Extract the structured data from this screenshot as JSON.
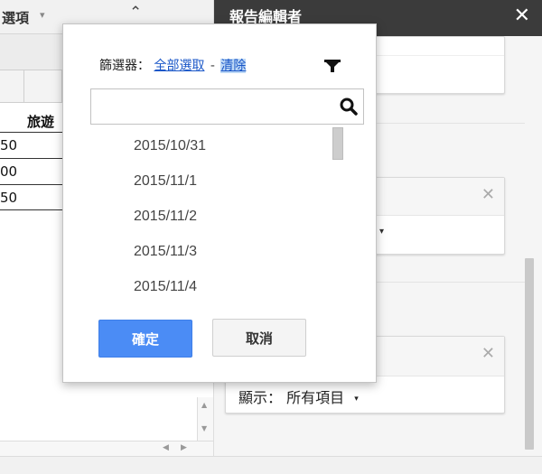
{
  "sheet": {
    "toolbar_cut_label": "選項",
    "toolbar_arrow": "▾",
    "collapse_icon_glyph": "⌃",
    "column_header": "旅遊",
    "row_values": [
      "50",
      "00",
      "50"
    ]
  },
  "panel": {
    "title": "報告編輯者",
    "close_glyph": "✕",
    "card_close_glyph": "✕",
    "card2_fragment": "▾",
    "show_label": "顯示：",
    "show_value": "所有項目",
    "show_arrow": "▾"
  },
  "filter_popup": {
    "label": "篩選器：",
    "select_all_link": "全部選取",
    "separator": "-",
    "clear_link": "清除",
    "search": {
      "value": "",
      "placeholder": ""
    },
    "dates": [
      "2015/10/31",
      "2015/11/1",
      "2015/11/2",
      "2015/11/3",
      "2015/11/4"
    ],
    "ok_label": "確定",
    "cancel_label": "取消"
  },
  "icons": {
    "filter": "funnel-icon",
    "search": "magnifier-icon",
    "close": "close-icon"
  },
  "colors": {
    "ok_button": "#4b8cf5",
    "link": "#1a57c8",
    "panel_header": "#3b3b3b"
  }
}
